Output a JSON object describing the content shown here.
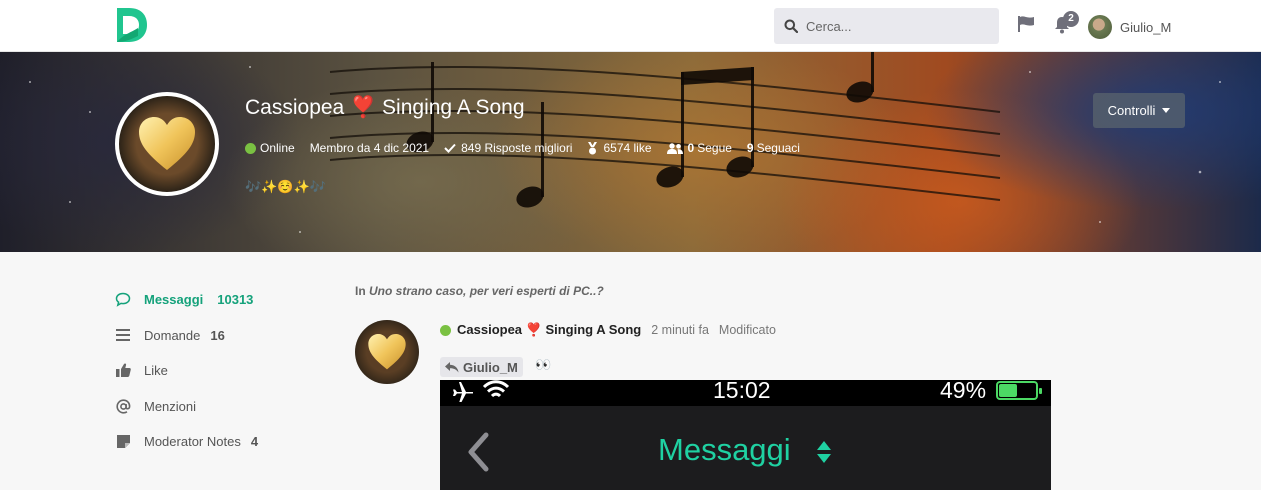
{
  "navbar": {
    "search_placeholder": "Cerca...",
    "notification_count": "2",
    "username": "Giulio_M"
  },
  "profile": {
    "name": "Cassiopea ❣️ Singing A Song",
    "status": "Online",
    "member_since": "Membro da 4 dic 2021",
    "best_answers": "849 Risposte migliori",
    "likes": "6574 like",
    "following_count": "0",
    "following_label": "Segue",
    "followers_count": "9",
    "followers_label": "Seguaci",
    "bio": "🎶✨☺️✨🎶",
    "controls_label": "Controlli"
  },
  "sidebar": {
    "items": [
      {
        "label": "Messaggi",
        "count": "10313",
        "icon": "chat-bubble-icon"
      },
      {
        "label": "Domande",
        "count": "16",
        "icon": "list-icon"
      },
      {
        "label": "Like",
        "count": "",
        "icon": "thumbs-up-icon"
      },
      {
        "label": "Menzioni",
        "count": "",
        "icon": "at-icon"
      },
      {
        "label": "Moderator Notes",
        "count": "4",
        "icon": "note-icon"
      }
    ]
  },
  "post": {
    "in_label": "In",
    "topic": "Uno strano caso, per veri esperti di PC..?",
    "author": "Cassiopea ❣️ Singing A Song",
    "time": "2 minuti fa",
    "edited": "Modificato",
    "reply_to": "Giulio_M",
    "reaction": "👀",
    "screenshot": {
      "clock": "15:02",
      "battery": "49%",
      "title": "Messaggi"
    }
  },
  "colors": {
    "accent": "#15a27b",
    "online": "#7ac142",
    "phone_title": "#1fd1a2",
    "battery": "#4cd964"
  }
}
